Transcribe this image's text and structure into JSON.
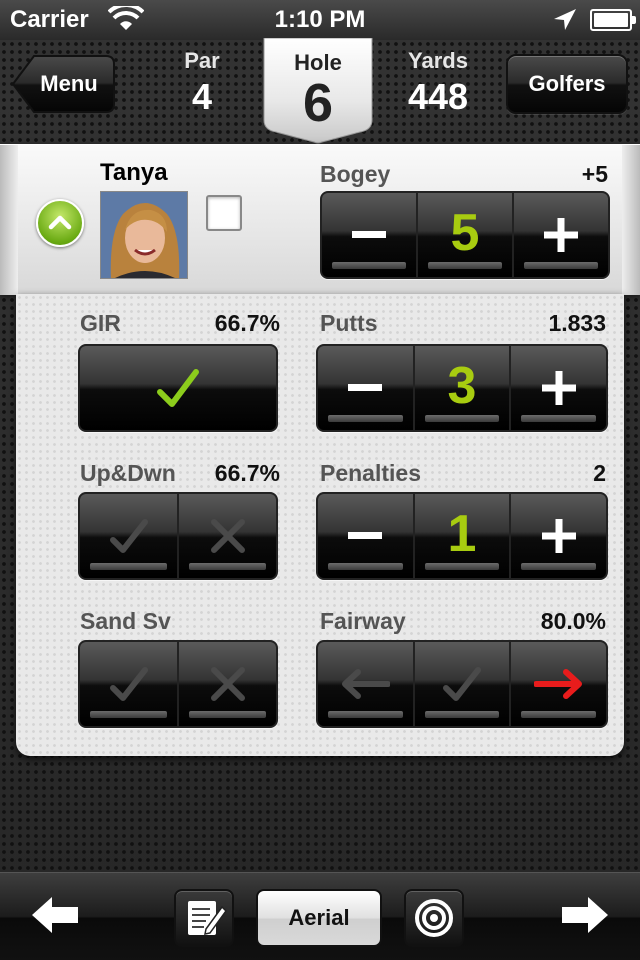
{
  "status_bar": {
    "carrier": "Carrier",
    "time": "1:10 PM"
  },
  "header": {
    "menu_label": "Menu",
    "golfers_label": "Golfers",
    "par_label": "Par",
    "par_value": "4",
    "hole_label": "Hole",
    "hole_value": "6",
    "yards_label": "Yards",
    "yards_value": "448"
  },
  "golfer": {
    "name": "Tanya",
    "score_label": "Bogey",
    "score_to_par": "+5",
    "strokes": "5"
  },
  "stats": {
    "gir": {
      "label": "GIR",
      "value": "66.7%",
      "hit": true
    },
    "putts": {
      "label": "Putts",
      "value": "1.833",
      "count": "3"
    },
    "updown": {
      "label": "Up&Dwn",
      "value": "66.7%"
    },
    "penalties": {
      "label": "Penalties",
      "value": "2",
      "count": "1"
    },
    "sandsave": {
      "label": "Sand Sv"
    },
    "fairway": {
      "label": "Fairway",
      "value": "80.0%",
      "selected": "right"
    }
  },
  "toolbar": {
    "aerial_label": "Aerial"
  },
  "colors": {
    "accent_green": "#a8cc10",
    "check_green": "#8ccc1c",
    "miss_red": "#e81c1c"
  }
}
